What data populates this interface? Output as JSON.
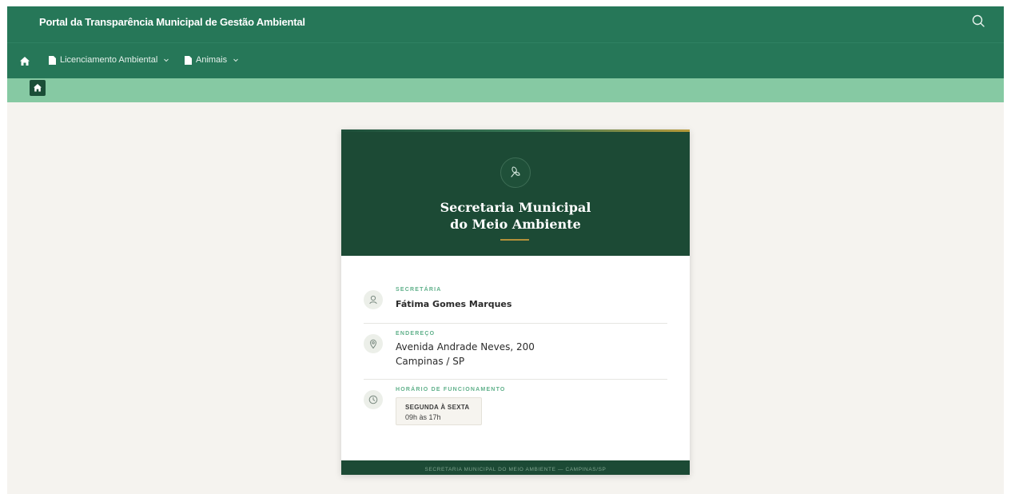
{
  "header": {
    "site_title": "Portal da Transparência Municipal de Gestão Ambiental",
    "search_icon": "search-icon"
  },
  "nav": {
    "home_icon": "home-icon",
    "items": [
      {
        "label": "Licenciamento Ambiental",
        "icon": "document-icon",
        "has_dropdown": true
      },
      {
        "label": "Animais",
        "icon": "document-icon",
        "has_dropdown": true
      }
    ]
  },
  "breadcrumb": {
    "home_icon": "home-icon"
  },
  "card": {
    "emblem_icon": "leaf-icon",
    "title_line1": "Secretaria Municipal",
    "title_line2": "do Meio Ambiente",
    "rows": [
      {
        "icon": "person-icon",
        "label": "SECRETÁRIA",
        "value": "Fátima Gomes Marques"
      },
      {
        "icon": "location-pin-icon",
        "label": "ENDEREÇO",
        "value_line1": "Avenida Andrade Neves, 200",
        "value_line2": "Campinas / SP"
      },
      {
        "icon": "clock-icon",
        "label": "HORÁRIO DE FUNCIONAMENTO",
        "days": "SEGUNDA À SEXTA",
        "time": "09h às 17h"
      }
    ],
    "footer": "SECRETARIA MUNICIPAL DO MEIO AMBIENTE — CAMPINAS/SP"
  },
  "colors": {
    "topbar": "#267758",
    "breadcrumb_bar": "#86c9a3",
    "card_header": "#1c4a35",
    "accent_gold": "#b3913a",
    "label_green": "#5fb08a",
    "page_background": "#f5f3ef"
  }
}
